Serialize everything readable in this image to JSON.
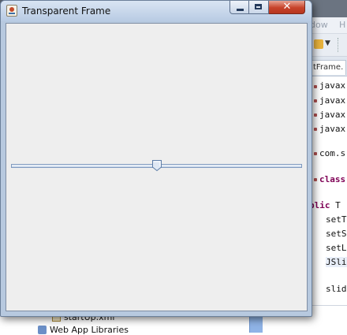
{
  "frame": {
    "title": "Transparent Frame",
    "close_glyph": "✕"
  },
  "slider": {
    "value": 50,
    "min": 0,
    "max": 100
  },
  "ide": {
    "menu": [
      "dow",
      "H"
    ],
    "tab_label": "tFrame.",
    "code_lines": [
      {
        "prefix": "",
        "text": "javax"
      },
      {
        "prefix": "",
        "text": "javax"
      },
      {
        "prefix": "",
        "text": "javax"
      },
      {
        "prefix": "",
        "text": "javax"
      },
      {
        "prefix": "",
        "text": "com.s"
      },
      {
        "prefix": "",
        "kw": "class"
      },
      {
        "prefix": "blic ",
        "kw": "",
        "text": "T"
      },
      {
        "prefix": "",
        "text": "setT"
      },
      {
        "prefix": "",
        "text": "setS"
      },
      {
        "prefix": "",
        "text": "setL"
      },
      {
        "prefix": "",
        "text": "JSli"
      },
      {
        "prefix": "",
        "text": "slid"
      }
    ],
    "tree": [
      {
        "label": "startUp.xml"
      },
      {
        "label": "Web App Libraries"
      }
    ]
  },
  "colors": {
    "accent": "#b8cbe3",
    "close": "#c7432b",
    "content_bg": "#eeeeee"
  }
}
